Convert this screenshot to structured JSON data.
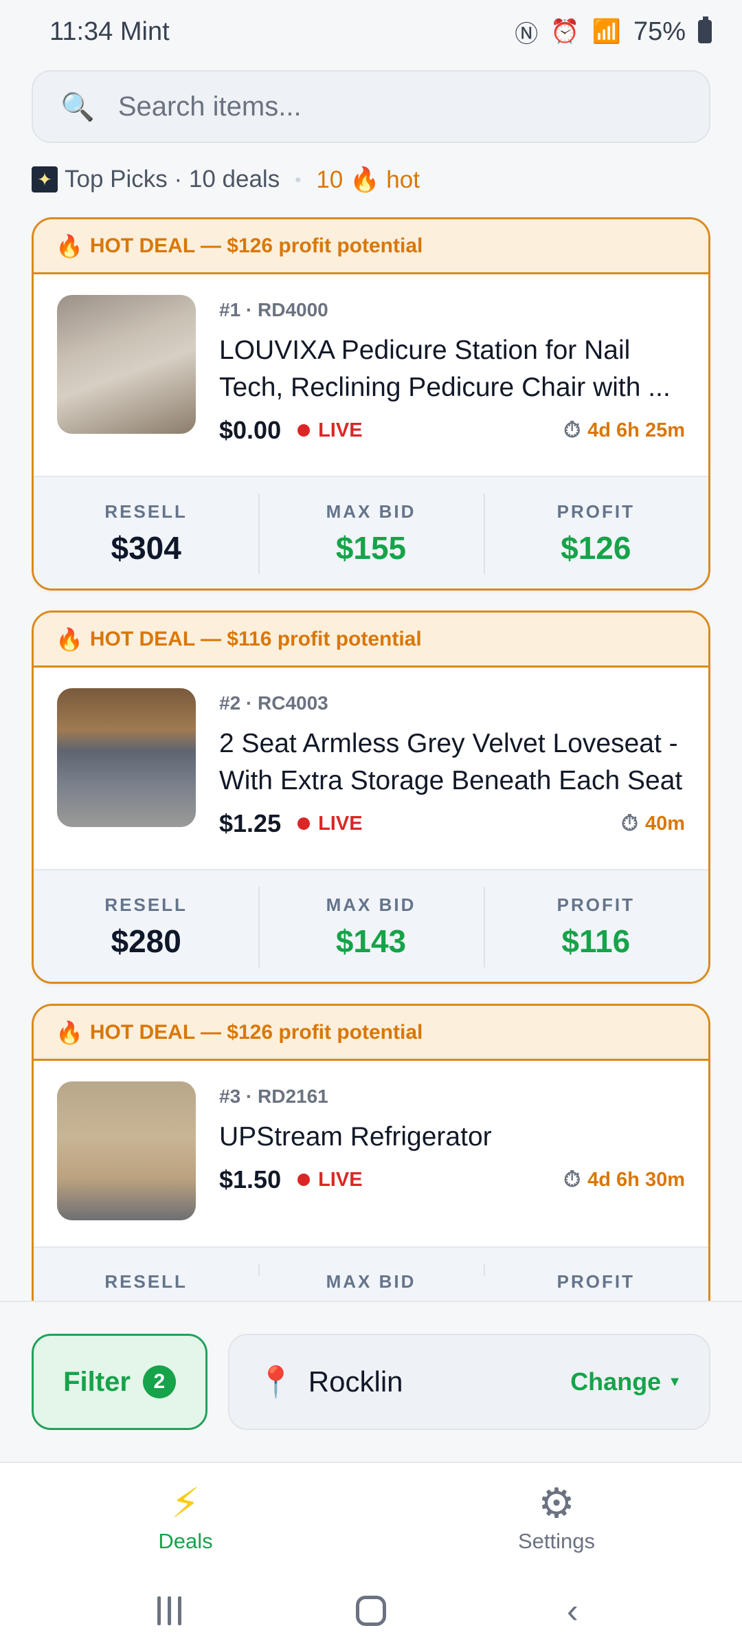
{
  "status_bar": {
    "time": "11:34",
    "carrier": "Mint",
    "battery": "75%"
  },
  "search": {
    "placeholder": "Search items..."
  },
  "summary": {
    "top_picks": "Top Picks · 10 deals",
    "hot": "10 🔥 hot"
  },
  "deals": [
    {
      "banner": "HOT DEAL — $126 profit potential",
      "id_line": "#1 · RD4000",
      "title": "LOUVIXA Pedicure Station for Nail Tech, Reclining Pedicure Chair with ...",
      "price": "$0.00",
      "live": "LIVE",
      "time_left": "4d 6h 25m",
      "resell_label": "RESELL",
      "resell": "$304",
      "max_bid_label": "MAX BID",
      "max_bid": "$155",
      "profit_label": "PROFIT",
      "profit": "$126"
    },
    {
      "banner": "HOT DEAL — $116 profit potential",
      "id_line": "#2 · RC4003",
      "title": "2 Seat Armless Grey Velvet Loveseat - With Extra Storage Beneath Each Seat",
      "price": "$1.25",
      "live": "LIVE",
      "time_left": "40m",
      "resell_label": "RESELL",
      "resell": "$280",
      "max_bid_label": "MAX BID",
      "max_bid": "$143",
      "profit_label": "PROFIT",
      "profit": "$116"
    },
    {
      "banner": "HOT DEAL — $126 profit potential",
      "id_line": "#3 · RD2161",
      "title": "UPStream Refrigerator",
      "price": "$1.50",
      "live": "LIVE",
      "time_left": "4d 6h 30m",
      "resell_label": "RESELL",
      "resell": "",
      "max_bid_label": "MAX BID",
      "max_bid": "",
      "profit_label": "PROFIT",
      "profit": ""
    }
  ],
  "filter": {
    "label": "Filter",
    "count": "2"
  },
  "location": {
    "name": "Rocklin",
    "change_label": "Change"
  },
  "nav": {
    "deals_label": "Deals",
    "settings_label": "Settings"
  },
  "colors": {
    "accent_green": "#16a34a",
    "hot_orange": "#d97706",
    "live_red": "#dc2626"
  }
}
